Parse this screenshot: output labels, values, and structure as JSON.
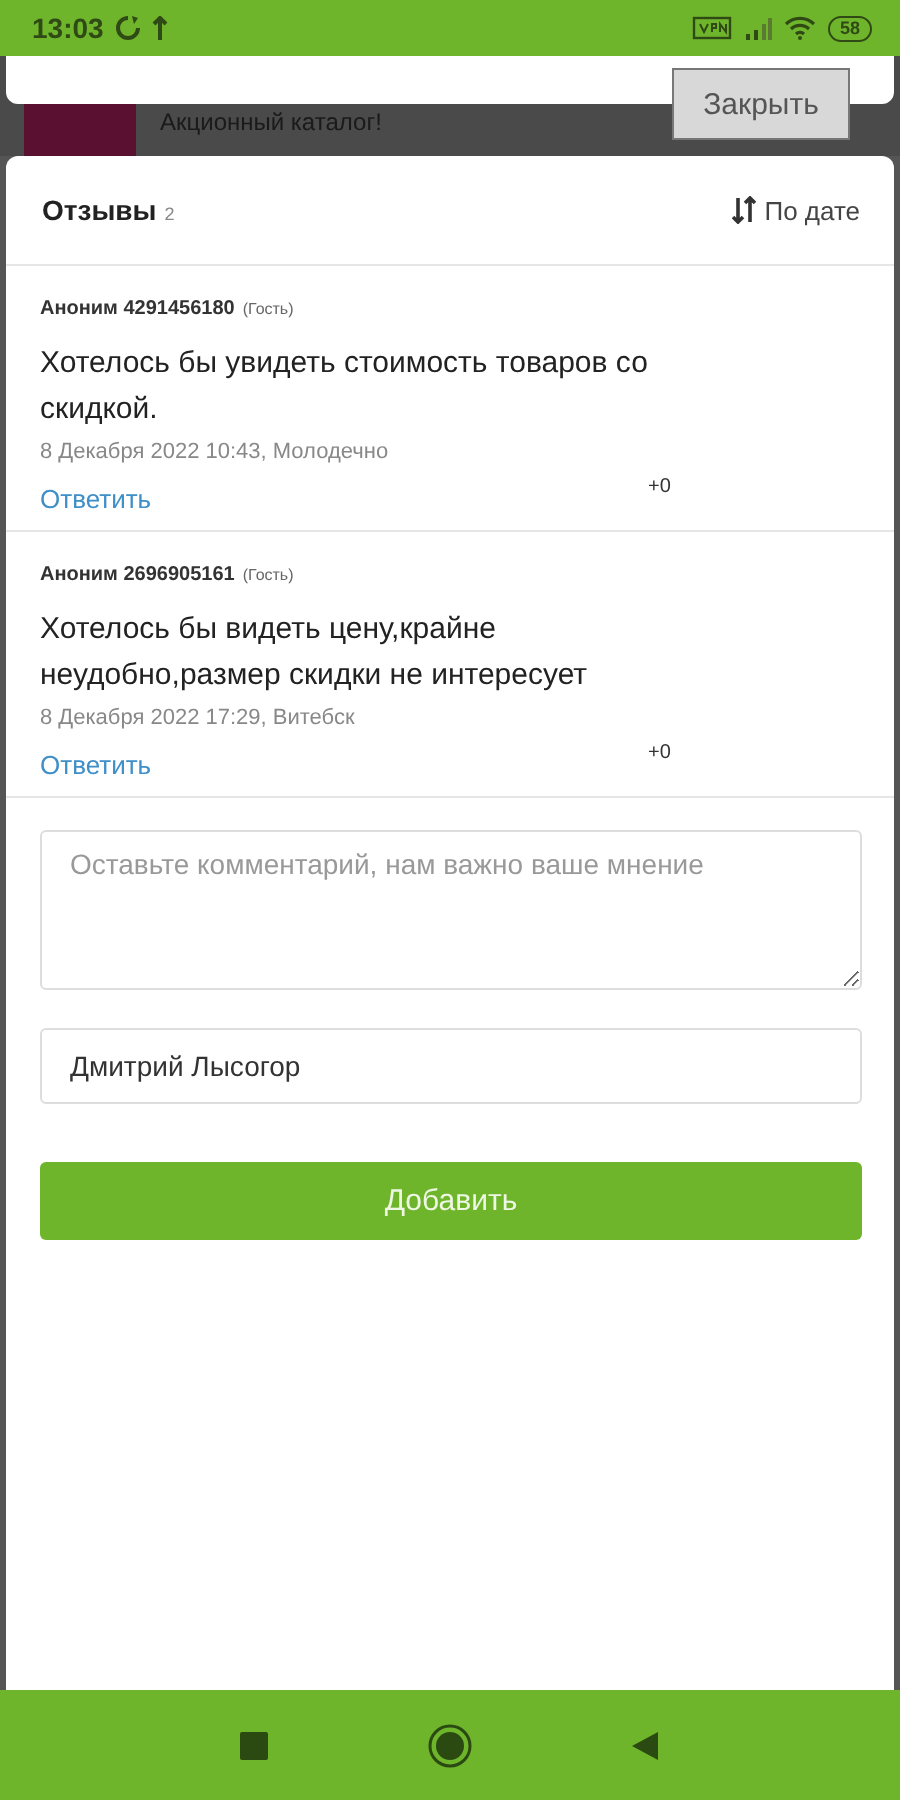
{
  "status_bar": {
    "time": "13:03",
    "battery": "58"
  },
  "background": {
    "catalog_title": "Акционный каталог!",
    "close_button": "Закрыть"
  },
  "reviews": {
    "title": "Отзывы",
    "count": "2",
    "sort": "По дате",
    "comments": [
      {
        "author": "Аноним 4291456180",
        "role": "(Гость)",
        "text": "Хотелось бы увидеть стоимость товаров со скидкой.",
        "meta": "8 Декабря 2022 10:43, Молодечно",
        "reply": "Ответить",
        "score": "+0"
      },
      {
        "author": "Аноним 2696905161",
        "role": "(Гость)",
        "text": "Хотелось бы видеть цену,крайне неудобно,размер скидки не интересует",
        "meta": "8 Декабря 2022 17:29, Витебск",
        "reply": "Ответить",
        "score": "+0"
      }
    ],
    "form": {
      "comment_placeholder": "Оставьте комментарий, нам важно ваше мнение",
      "name_value": "Дмитрий Лысогор",
      "submit": "Добавить"
    }
  }
}
